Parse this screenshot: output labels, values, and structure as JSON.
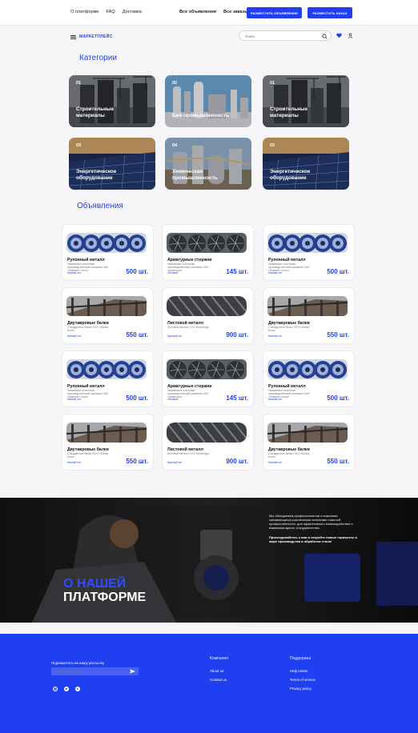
{
  "topbar": {
    "links": [
      "О платформе",
      "FAQ",
      "Доставка"
    ],
    "links2": [
      "Все объявления",
      "Все заказы"
    ],
    "btn_ad": "РАЗМЕСТИТЬ ОБЪЯВЛЕНИЕ",
    "btn_order": "РАЗМЕСТИТЬ ЗАКАЗ"
  },
  "nav": {
    "brand": "МАРКЕТПЛЕЙС",
    "search_placeholder": "Поиск"
  },
  "categories_title": "Категории",
  "categories": [
    {
      "num": "01",
      "label": "Строительные материалы"
    },
    {
      "num": "02",
      "label": "Био промышленность"
    },
    {
      "num": "01",
      "label": "Строительные материалы"
    },
    {
      "num": "03",
      "label": "Энергетическое оборудование"
    },
    {
      "num": "04",
      "label": "Химическая промышленность"
    },
    {
      "num": "03",
      "label": "Энергетическое оборудование"
    }
  ],
  "ads_title": "Объявления",
  "ads": [
    {
      "title": "Рулонный металл",
      "desc": "Уважаемые участники производственной компании ЗАО «Ламинат сталь»",
      "meta": "Мелкий опт",
      "qty": "500 шт."
    },
    {
      "title": "Арматурные стержни",
      "desc": "Уважаемые участники производственной компании ЗАО «Арматура»",
      "meta": "Оптовые",
      "qty": "145 шт."
    },
    {
      "title": "Рулонный металл",
      "desc": "Уважаемые участники производственной компании ЗАО «Ламинат сталь»",
      "meta": "Мелкий опт",
      "qty": "500 шт."
    },
    {
      "title": "Двутавровые балки",
      "desc": "Стандартные балки ООО «Балка-Блок»",
      "meta": "Мелкий опт",
      "qty": "550 шт."
    },
    {
      "title": "Листовой металл",
      "desc": "Листовой металл ООО Металлург",
      "meta": "Крупный опт",
      "qty": "900 шт."
    },
    {
      "title": "Двутавровые балки",
      "desc": "Стандартные балки ООО «Балка-Блок»",
      "meta": "Мелкий опт",
      "qty": "550 шт."
    },
    {
      "title": "Рулонный металл",
      "desc": "Уважаемые участники производственной компании ЗАО «Ламинат сталь»",
      "meta": "Мелкий опт",
      "qty": "500 шт."
    },
    {
      "title": "Арматурные стержни",
      "desc": "Уважаемые участники производственной компании ЗАО «Арматура»",
      "meta": "Оптовые",
      "qty": "145 шт."
    },
    {
      "title": "Рулонный металл",
      "desc": "Уважаемые участники производственной компании ЗАО «Ламинат сталь»",
      "meta": "Мелкий опт",
      "qty": "500 шт."
    },
    {
      "title": "Двутавровые балки",
      "desc": "Стандартные балки ООО «Балка-Блок»",
      "meta": "Мелкий опт",
      "qty": "550 шт."
    },
    {
      "title": "Листовой металл",
      "desc": "Листовой металл ООО Металлург",
      "meta": "Крупный опт",
      "qty": "900 шт."
    },
    {
      "title": "Двутавровые балки",
      "desc": "Стандартные балки ООО «Балка-Блок»",
      "meta": "Мелкий опт",
      "qty": "550 шт."
    }
  ],
  "about": {
    "title1": "О НАШЕЙ",
    "title2": "ПЛАТФОРМЕ",
    "text1": "Мы объединяем профессионалов и компании, занимающихся различными аспектами тяжелой промышленности, для эффективного взаимодействия и взаимовыгодного сотрудничества.",
    "text2": "Присоединяйтесь к нам и откройте новые горизонты в мире производства и обработки стали!"
  },
  "footer": {
    "subscribe_label": "Подпишитесь на нашу рассылку",
    "email_placeholder": "Электронная почта",
    "col1_title": "Компания",
    "col1_items": [
      "About us",
      "Contact us"
    ],
    "col2_title": "Поддержка",
    "col2_items": [
      "Help center",
      "Terms of service",
      "Privacy policy"
    ]
  },
  "colors": {
    "accent": "#1f3ff0"
  }
}
